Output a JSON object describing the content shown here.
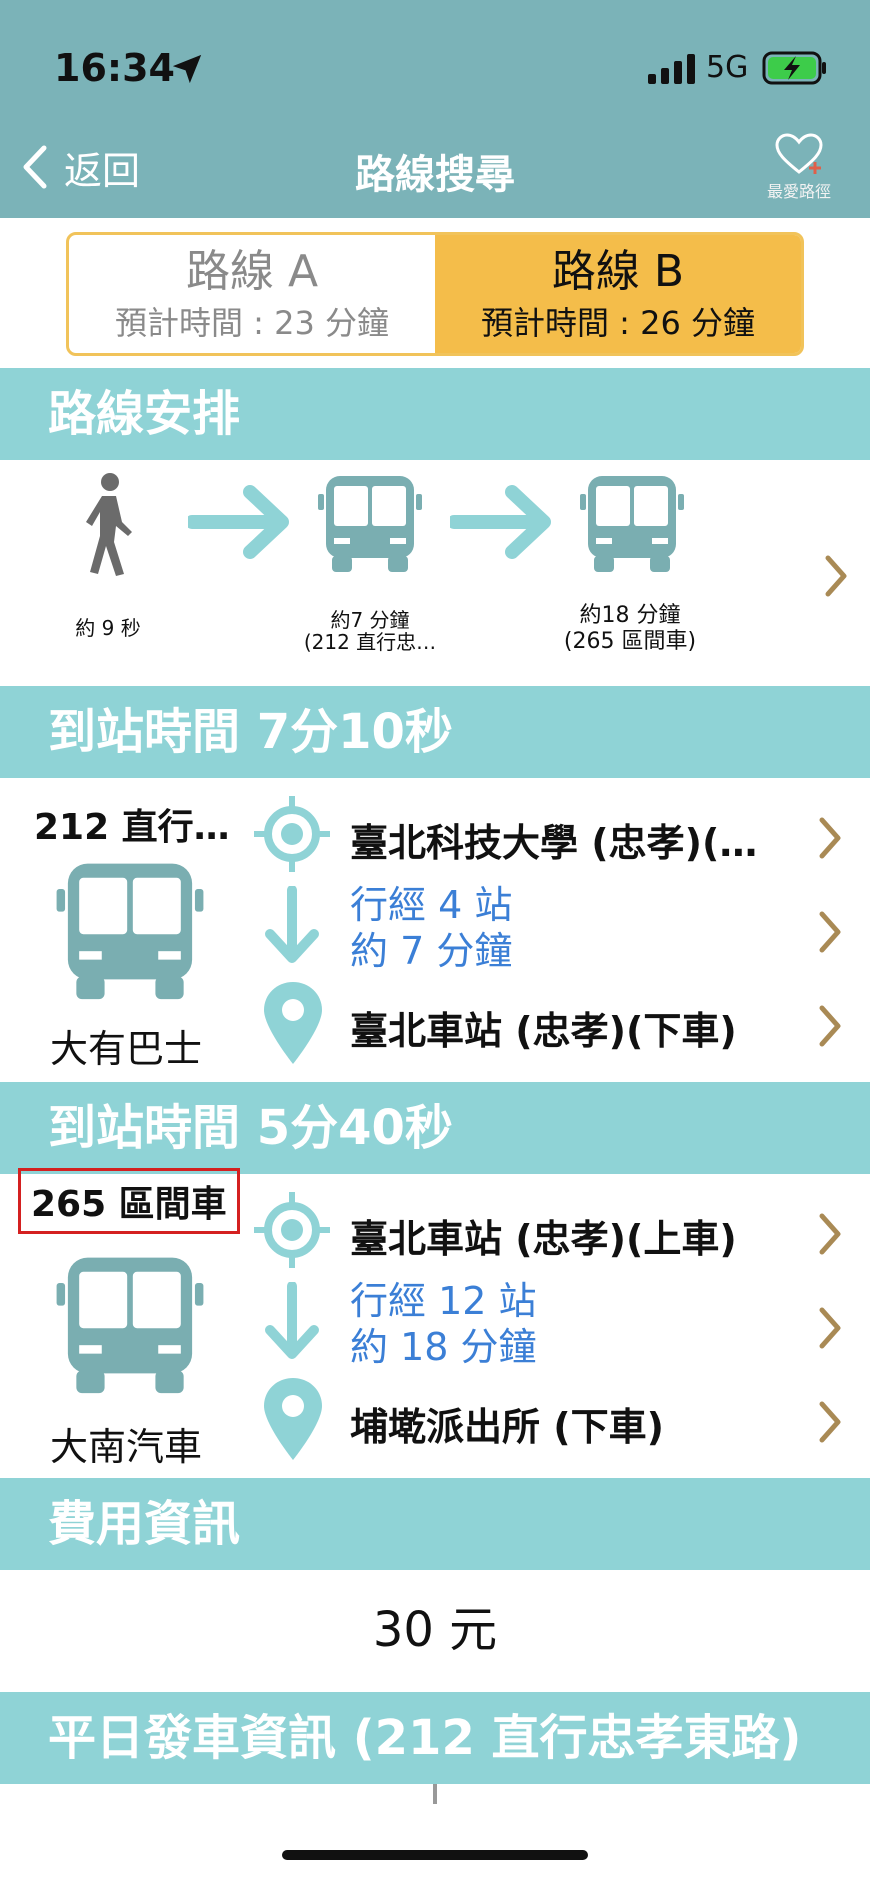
{
  "status_bar": {
    "time": "16:34",
    "network": "5G"
  },
  "nav": {
    "back_label": "返回",
    "title": "路線搜尋",
    "favorite_label": "最愛路徑"
  },
  "route_tabs": [
    {
      "name": "路線 A",
      "time": "預計時間 : 23 分鐘",
      "selected": false
    },
    {
      "name": "路線 B",
      "time": "預計時間 : 26 分鐘",
      "selected": true
    }
  ],
  "route_plan": {
    "header": "路線安排",
    "steps": [
      {
        "icon": "walk-icon",
        "label_line1": "約 9 秒",
        "label_line2": ""
      },
      {
        "icon": "bus-icon",
        "label_line1": "約7 分鐘",
        "label_line2": "(212 直行忠…"
      },
      {
        "icon": "bus-icon",
        "label_line1": "約18 分鐘",
        "label_line2": "(265 區間車)"
      }
    ]
  },
  "legs": [
    {
      "arrival_header": "到站時間 7分10秒",
      "route_name": "212 直行…",
      "operator": "大有巴士",
      "board_stop": "臺北科技大學 (忠孝)(…",
      "via_stops": "行經 4 站",
      "via_time": "約 7 分鐘",
      "alight_stop": "臺北車站 (忠孝)(下車)"
    },
    {
      "arrival_header": "到站時間 5分40秒",
      "route_name": "265 區間車",
      "operator": "大南汽車",
      "board_stop": "臺北車站 (忠孝)(上車)",
      "via_stops": "行經 12 站",
      "via_time": "約 18 分鐘",
      "alight_stop": "埔墘派出所 (下車)"
    }
  ],
  "fare": {
    "header": "費用資訊",
    "amount": "30 元"
  },
  "schedule": {
    "header": "平日發車資訊 (212 直行忠孝東路)"
  },
  "colors": {
    "header_bg": "#7bb3b8",
    "section_bg": "#8fd3d6",
    "selected_tab": "#f4bd4a",
    "icon_teal": "#7aaeb1",
    "via_text": "#3b7fd6",
    "chevron": "#a98a55",
    "highlight_box": "#d42020"
  }
}
